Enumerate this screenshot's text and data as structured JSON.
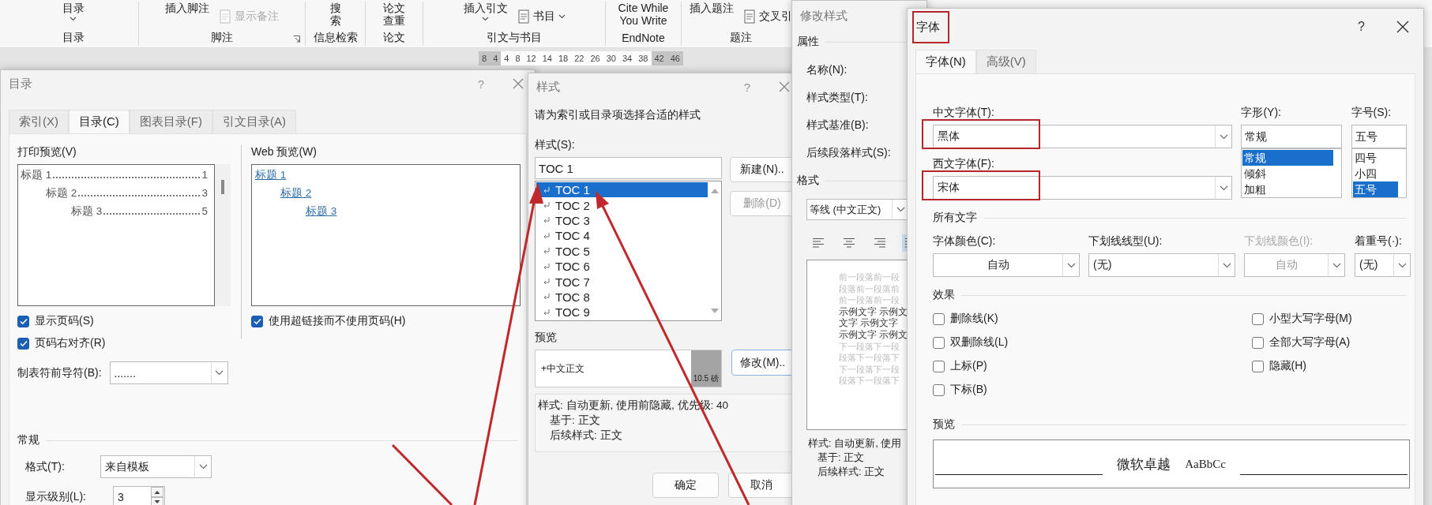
{
  "ribbon": {
    "groups": [
      {
        "label": "目录",
        "launcher": false,
        "items": [
          {
            "kind": "big",
            "label": "目录",
            "caret": true
          }
        ]
      },
      {
        "label": "脚注",
        "launcher": true,
        "items": [
          {
            "kind": "big",
            "label": "插入脚注",
            "caret": false
          },
          {
            "kind": "small",
            "label": "显示备注",
            "disabled": true,
            "caret": false
          }
        ]
      },
      {
        "label": "信息检索",
        "launcher": false,
        "items": [
          {
            "kind": "big",
            "label": "搜索",
            "caret": false
          }
        ]
      },
      {
        "label": "论文",
        "launcher": false,
        "items": [
          {
            "kind": "big",
            "label": "论文查重",
            "caret": false
          }
        ]
      },
      {
        "label": "引文与书目",
        "launcher": false,
        "items": [
          {
            "kind": "big",
            "label": "插入引文",
            "caret": true
          },
          {
            "kind": "small",
            "label": "书目",
            "disabled": false,
            "caret": true
          }
        ]
      },
      {
        "label": "EndNote",
        "launcher": false,
        "items": [
          {
            "kind": "big",
            "label": "Cite While You Write",
            "caret": false
          }
        ]
      },
      {
        "label": "题注",
        "launcher": false,
        "items": [
          {
            "kind": "big",
            "label": "插入题注",
            "caret": false
          },
          {
            "kind": "small",
            "label": "交叉引",
            "disabled": false,
            "caret": false
          }
        ]
      }
    ]
  },
  "ruler": {
    "ticks": [
      {
        "label": "8",
        "margin": true
      },
      {
        "label": "4",
        "margin": true
      },
      {
        "label": "4",
        "margin": false
      },
      {
        "label": "8",
        "margin": false
      },
      {
        "label": "12",
        "margin": false
      },
      {
        "label": "14",
        "margin": false
      },
      {
        "label": "18",
        "margin": false
      },
      {
        "label": "22",
        "margin": false
      },
      {
        "label": "26",
        "margin": false
      },
      {
        "label": "30",
        "margin": false
      },
      {
        "label": "34",
        "margin": false
      },
      {
        "label": "38",
        "margin": false
      },
      {
        "label": "42",
        "margin": true
      },
      {
        "label": "46",
        "margin": true
      }
    ]
  },
  "toc_dialog": {
    "title": "目录",
    "help": "?",
    "tabs": [
      {
        "label": "索引(X)",
        "selected": false
      },
      {
        "label": "目录(C)",
        "selected": true
      },
      {
        "label": "图表目录(F)",
        "selected": false
      },
      {
        "label": "引文目录(A)",
        "selected": false
      }
    ],
    "print_preview": {
      "label": "打印预览(V)",
      "entries": [
        {
          "text": "标题 1",
          "page": "1",
          "children": [
            {
              "text": "标题 2",
              "page": "3",
              "children": [
                {
                  "text": "标题 3",
                  "page": "5"
                }
              ]
            }
          ]
        }
      ]
    },
    "web_preview": {
      "label": "Web 预览(W)",
      "entries": [
        {
          "text": "标题 1",
          "children": [
            {
              "text": "标题 2",
              "children": [
                {
                  "text": "标题 3"
                }
              ]
            }
          ]
        }
      ]
    },
    "options": [
      {
        "label": "显示页码(S)",
        "checked": true
      },
      {
        "label": "页码右对齐(R)",
        "checked": true
      }
    ],
    "hyperlink_option": {
      "label": "使用超链接而不使用页码(H)",
      "checked": true
    },
    "tab_leader": {
      "label": "制表符前导符(B):",
      "value": "......."
    },
    "general": {
      "title": "常规",
      "format": {
        "label": "格式(T):",
        "value": "来自模板"
      },
      "levels": {
        "label": "显示级别(L):",
        "value": "3"
      }
    }
  },
  "style_dialog": {
    "title": "样式",
    "help": "?",
    "prompt": "请为索引或目录项选择合适的样式",
    "style_label": "样式(S):",
    "style_value": "TOC 1",
    "styles": [
      {
        "name": "TOC 1",
        "selected": true
      },
      {
        "name": "TOC 2",
        "selected": false
      },
      {
        "name": "TOC 3",
        "selected": false
      },
      {
        "name": "TOC 4",
        "selected": false
      },
      {
        "name": "TOC 5",
        "selected": false
      },
      {
        "name": "TOC 6",
        "selected": false
      },
      {
        "name": "TOC 7",
        "selected": false
      },
      {
        "name": "TOC 8",
        "selected": false
      },
      {
        "name": "TOC 9",
        "selected": false
      }
    ],
    "side_buttons": [
      {
        "label": "新建(N)..",
        "disabled": false
      },
      {
        "label": "删除(D)",
        "disabled": true
      }
    ],
    "preview_label": "预览",
    "preview_font": "+中文正文",
    "preview_size": "10.5 磅",
    "modify_button": "修改(M)..",
    "description": [
      {
        "text": "样式: 自动更新, 使用前隐藏, 优先级: 40",
        "kind": "head"
      },
      {
        "text": "基于: 正文",
        "kind": "detail"
      },
      {
        "text": "后续样式: 正文",
        "kind": "detail"
      }
    ],
    "buttons": [
      "确定",
      "取消"
    ]
  },
  "modify_dialog": {
    "title": "修改样式",
    "properties_title": "属性",
    "fields": [
      "名称(N):",
      "样式类型(T):",
      "样式基准(B):",
      "后续段落样式(S):"
    ],
    "format_title": "格式",
    "font_value": "等线 (中文正文)",
    "alignments": [
      {
        "kind": "left",
        "selected": false
      },
      {
        "kind": "center",
        "selected": false
      },
      {
        "kind": "right",
        "selected": false
      },
      {
        "kind": "justify",
        "selected": true
      }
    ],
    "preview_lines": [
      {
        "text": "前一段落前一段",
        "kind": "context"
      },
      {
        "text": "段落前一段落前",
        "kind": "context"
      },
      {
        "text": "前一段落前一段",
        "kind": "context"
      },
      {
        "text": "示例文字  示例文",
        "kind": "sample"
      },
      {
        "text": "文字  示例文字",
        "kind": "sample"
      },
      {
        "text": "示例文字  示例文",
        "kind": "sample"
      },
      {
        "text": "下一段落下一段",
        "kind": "context"
      },
      {
        "text": "段落下一段落下",
        "kind": "context"
      },
      {
        "text": "下一段落下一段",
        "kind": "context"
      },
      {
        "text": "段落下一段落下",
        "kind": "context"
      }
    ],
    "description": [
      {
        "text": "样式: 自动更新, 使用",
        "kind": "head"
      },
      {
        "text": "基于: 正文",
        "kind": "detail"
      },
      {
        "text": "后续样式: 正文",
        "kind": "detail"
      }
    ]
  },
  "font_dialog": {
    "title": "字体",
    "title_highlighted": true,
    "help": "?",
    "tabs": [
      {
        "label": "字体(N)",
        "selected": true
      },
      {
        "label": "高级(V)",
        "selected": false
      }
    ],
    "chinese_font": {
      "label": "中文字体(T):",
      "value": "黑体",
      "highlighted": true
    },
    "western_font": {
      "label": "西文字体(F):",
      "value": "宋体",
      "highlighted": true
    },
    "style": {
      "label": "字形(Y):",
      "value": "常规",
      "options": [
        {
          "label": "常规",
          "selected": true
        },
        {
          "label": "倾斜",
          "selected": false
        },
        {
          "label": "加粗",
          "selected": false
        }
      ]
    },
    "size": {
      "label": "字号(S):",
      "value": "五号",
      "options": [
        {
          "label": "四号",
          "selected": false
        },
        {
          "label": "小四",
          "selected": false
        },
        {
          "label": "五号",
          "selected": true
        }
      ]
    },
    "all_text_title": "所有文字",
    "dropdowns": [
      {
        "label": "字体颜色(C):",
        "value": "自动",
        "disabled": false
      },
      {
        "label": "下划线线型(U):",
        "value": "(无)",
        "disabled": false
      },
      {
        "label": "下划线颜色(I):",
        "value": "自动",
        "disabled": true
      },
      {
        "label": "着重号(·):",
        "value": "(无)",
        "disabled": false
      }
    ],
    "effects_title": "效果",
    "effects_left": [
      {
        "label": "删除线(K)",
        "checked": false
      },
      {
        "label": "双删除线(L)",
        "checked": false
      },
      {
        "label": "上标(P)",
        "checked": false
      },
      {
        "label": "下标(B)",
        "checked": false
      }
    ],
    "effects_right": [
      {
        "label": "小型大写字母(M)",
        "checked": false
      },
      {
        "label": "全部大写字母(A)",
        "checked": false
      },
      {
        "label": "隐藏(H)",
        "checked": false
      }
    ],
    "preview_title": "预览",
    "preview_cjk": "微软卓越",
    "preview_latin": "AaBbCc"
  }
}
